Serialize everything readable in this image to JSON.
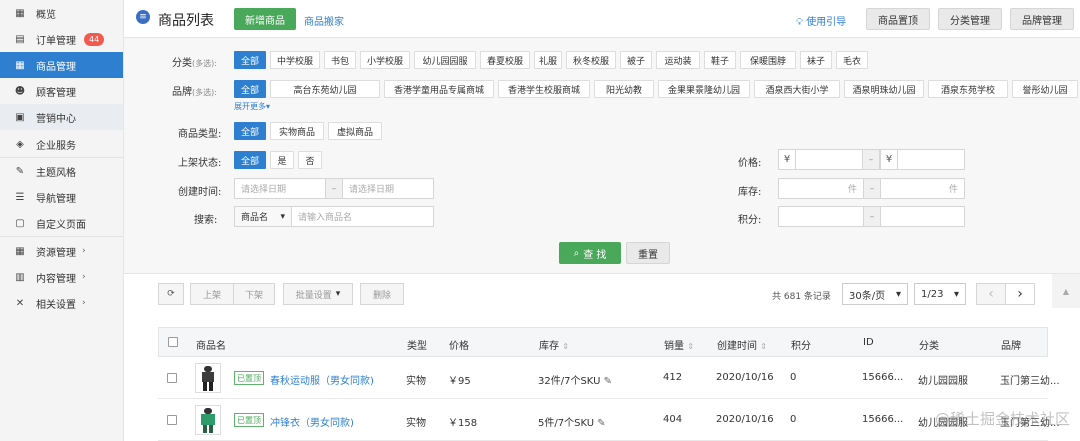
{
  "sidebar": {
    "items": [
      {
        "label": "概览",
        "icon": "grid-icon"
      },
      {
        "label": "订单管理",
        "icon": "clipboard-icon",
        "badge": "44"
      },
      {
        "label": "商品管理",
        "icon": "grid-icon",
        "active": true
      },
      {
        "label": "顾客管理",
        "icon": "user-icon"
      },
      {
        "label": "营销中心",
        "icon": "shop-icon"
      },
      {
        "label": "企业服务",
        "icon": "box-icon"
      },
      {
        "label": "主题风格",
        "icon": "brush-icon"
      },
      {
        "label": "导航管理",
        "icon": "nav-icon"
      },
      {
        "label": "自定义页面",
        "icon": "page-icon"
      },
      {
        "label": "资源管理",
        "icon": "resource-icon",
        "chevron": "›"
      },
      {
        "label": "内容管理",
        "icon": "content-icon",
        "chevron": "›"
      },
      {
        "label": "相关设置",
        "icon": "tools-icon",
        "chevron": "›"
      }
    ]
  },
  "header": {
    "title": "商品列表",
    "add_button": "新增商品",
    "move_link": "商品搬家",
    "guide_link": "使用引导",
    "btn_pin": "商品置顶",
    "btn_category": "分类管理",
    "btn_brand": "品牌管理"
  },
  "filter": {
    "category_label": "分类",
    "multi": "(多选):",
    "categories": [
      "全部",
      "中学校服",
      "书包",
      "小学校服",
      "幼儿园园服",
      "春夏校服",
      "礼服",
      "秋冬校服",
      "被子",
      "运动装",
      "鞋子",
      "保暖围脖",
      "袜子",
      "毛衣"
    ],
    "brand_label": "品牌",
    "brands": [
      "全部",
      "高台东苑幼儿园",
      "香港学童用品专属商城",
      "香港学生校服商城",
      "阳光幼教",
      "金果果景隆幼儿园",
      "酒泉西大街小学",
      "酒泉明珠幼儿园",
      "酒泉东苑学校",
      "誉彤幼儿园"
    ],
    "expand": "展开更多▾",
    "type_label": "商品类型:",
    "types": [
      "全部",
      "实物商品",
      "虚拟商品"
    ],
    "status_label": "上架状态:",
    "statuses": [
      "全部",
      "是",
      "否"
    ],
    "created_label": "创建时间:",
    "date_placeholder": "请选择日期",
    "search_label": "搜索:",
    "search_field": "商品名",
    "search_placeholder": "请输入商品名",
    "price_label": "价格:",
    "currency": "¥",
    "stock_label": "库存:",
    "unit": "件",
    "points_label": "积分:",
    "dash": "–",
    "query_button": "查 找",
    "reset_button": "重置"
  },
  "toolbar": {
    "refresh_icon": "refresh-icon",
    "on_shelf": "上架",
    "off_shelf": "下架",
    "batch": "批量设置",
    "delete": "删除",
    "total": "共 681 条记录",
    "page_size": "30条/页",
    "page": "1/23",
    "prev": "‹",
    "next": "›",
    "collapse": "▲"
  },
  "table": {
    "headers": [
      "商品名",
      "类型",
      "价格",
      "库存",
      "销量",
      "创建时间",
      "积分",
      "ID",
      "分类",
      "品牌"
    ],
    "sort_icon": "⇕",
    "rows": [
      {
        "tag": "已置顶",
        "name": "春秋运动服（男女同款)",
        "type": "实物",
        "price": "￥95",
        "stock": "32件/7个SKU",
        "sales": "412",
        "created": "2020/10/16",
        "points": "0",
        "id": "15666...",
        "category": "幼儿园园服",
        "brand": "玉门第三幼..."
      },
      {
        "tag": "已置顶",
        "name": "冲锋衣（男女同款)",
        "type": "实物",
        "price": "￥158",
        "stock": "5件/7个SKU",
        "sales": "404",
        "created": "2020/10/16",
        "points": "0",
        "id": "15666...",
        "category": "幼儿园园服",
        "brand": "玉门第三幼..."
      }
    ]
  },
  "watermark": "@稀土掘金技术社区"
}
